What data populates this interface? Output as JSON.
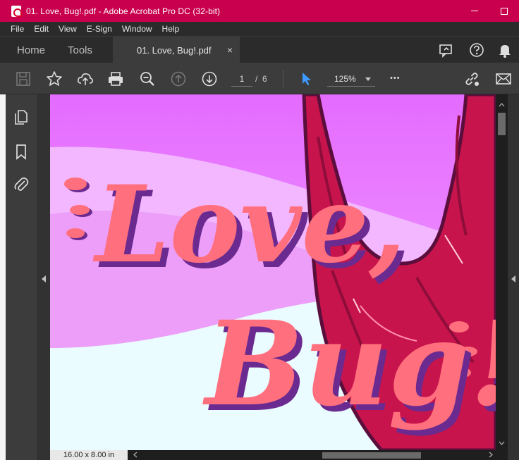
{
  "window": {
    "title": "01. Love, Bug!.pdf - Adobe Acrobat Pro DC (32-bit)"
  },
  "menu": [
    "File",
    "Edit",
    "View",
    "E-Sign",
    "Window",
    "Help"
  ],
  "tabs": {
    "home": "Home",
    "tools": "Tools",
    "document": "01. Love, Bug!.pdf",
    "close_glyph": "×"
  },
  "toolbar": {
    "page_current": "1",
    "page_separator": "/",
    "page_total": "6",
    "zoom": "125%",
    "more_glyph": "•••"
  },
  "document": {
    "artwork_title_line1": "Love,",
    "artwork_title_line2": "Bug!",
    "page_size": "16.00 x 8.00 in"
  },
  "colors": {
    "titlebar": "#c8004e",
    "accent_blue": "#3d9bff",
    "art_pink_text": "#ff6f7d",
    "art_shadow": "#6b2a8f",
    "art_red": "#c8144c"
  },
  "icons": {
    "left_panel": [
      "pages-icon",
      "bookmark-icon",
      "attachment-icon"
    ]
  }
}
